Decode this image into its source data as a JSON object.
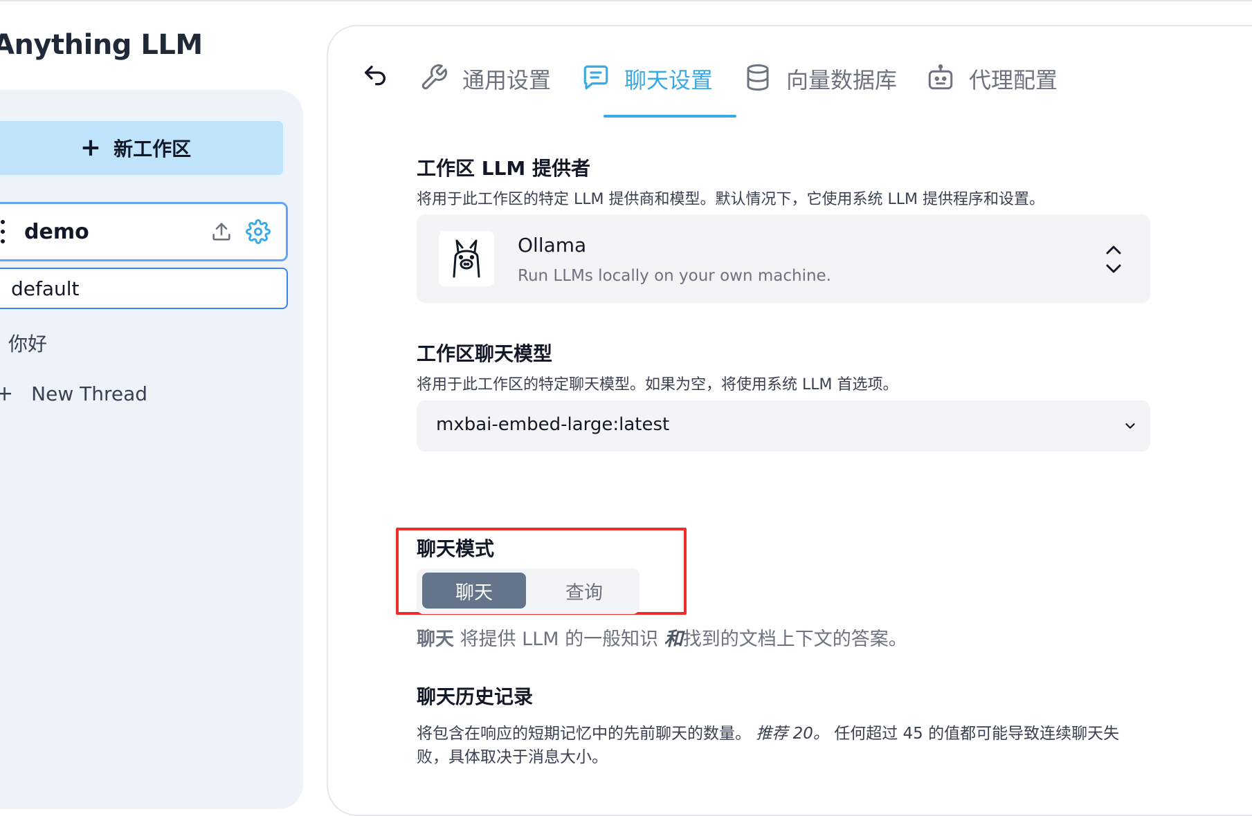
{
  "app": {
    "name": "Anything LLM"
  },
  "sidebar": {
    "new_workspace_label": "新工作区",
    "workspace": {
      "name": "demo"
    },
    "threads": [
      {
        "label": "default"
      },
      {
        "label": "你好"
      }
    ],
    "new_thread_label": "New Thread"
  },
  "tabs": {
    "general": "通用设置",
    "chat": "聊天设置",
    "vector_db": "向量数据库",
    "agent": "代理配置",
    "active": "chat"
  },
  "provider_section": {
    "title": "工作区 LLM 提供者",
    "desc": "将用于此工作区的特定 LLM 提供商和模型。默认情况下，它使用系统 LLM 提供程序和设置。",
    "selected_name": "Ollama",
    "selected_desc": "Run LLMs locally on your own machine."
  },
  "model_section": {
    "title": "工作区聊天模型",
    "desc": "将用于此工作区的特定聊天模型。如果为空，将使用系统 LLM 首选项。",
    "selected": "mxbai-embed-large:latest"
  },
  "mode_section": {
    "title": "聊天模式",
    "options": [
      "聊天",
      "查询"
    ],
    "active": "聊天",
    "desc_strong": "聊天",
    "desc_part1": " 将提供 LLM 的一般知识 ",
    "desc_em": "和",
    "desc_part2": "找到的文档上下文的答案。"
  },
  "history_section": {
    "title": "聊天历史记录",
    "desc_part1": "将包含在响应的短期记忆中的先前聊天的数量。 ",
    "desc_em": "推荐 20。",
    "desc_part2": " 任何超过 45 的值都可能导致连续聊天失败，具体取决于消息大小。"
  },
  "colors": {
    "accent": "#38a9e4",
    "highlight": "#ef2b2b",
    "toggle_active": "#64748b"
  }
}
